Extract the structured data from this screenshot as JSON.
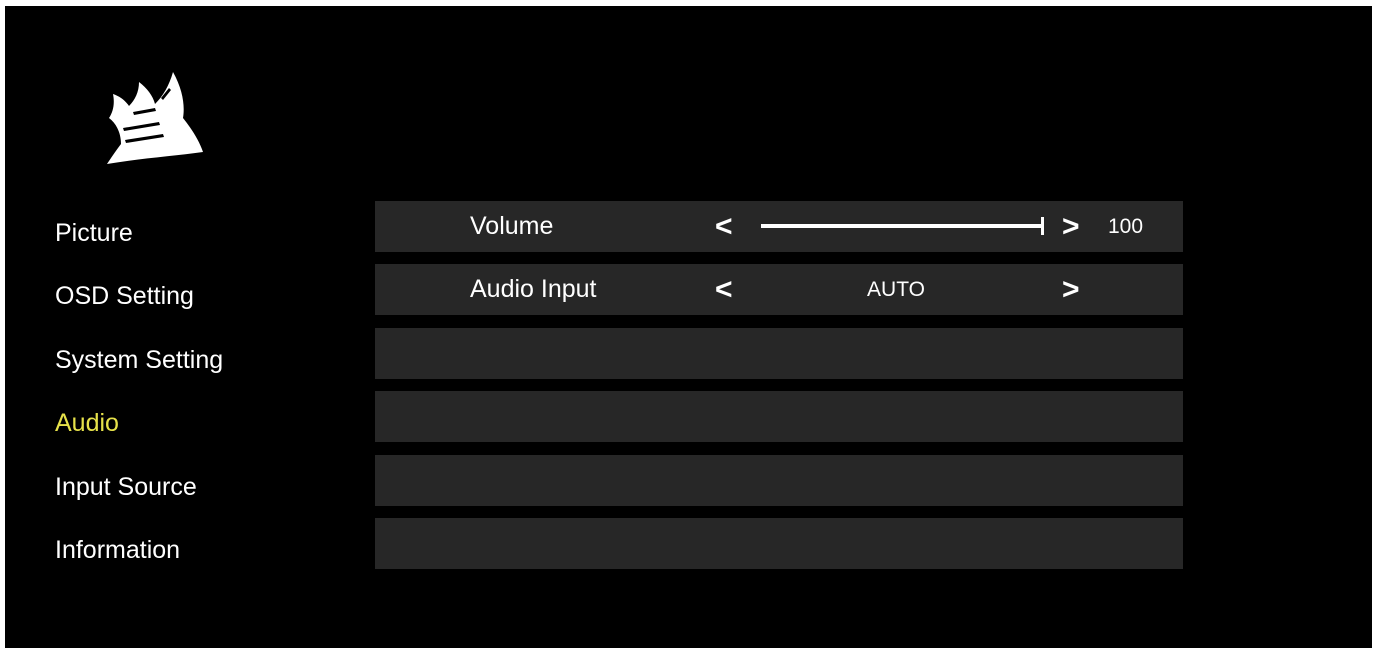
{
  "colors": {
    "background": "#000000",
    "row_background": "#272727",
    "text": "#ffffff",
    "active_menu_text": "#e6e14a"
  },
  "logo": {
    "icon": "corsair-sails-logo"
  },
  "menu": {
    "items": [
      {
        "label": "Picture",
        "active": false
      },
      {
        "label": "OSD Setting",
        "active": false
      },
      {
        "label": "System Setting",
        "active": false
      },
      {
        "label": "Audio",
        "active": true
      },
      {
        "label": "Input Source",
        "active": false
      },
      {
        "label": "Information",
        "active": false
      }
    ]
  },
  "settings": {
    "volume": {
      "label": "Volume",
      "left_arrow": "<",
      "right_arrow": ">",
      "value": "100",
      "level": 1.0
    },
    "audio_input": {
      "label": "Audio Input",
      "left_arrow": "<",
      "right_arrow": ">",
      "value": "AUTO"
    }
  }
}
